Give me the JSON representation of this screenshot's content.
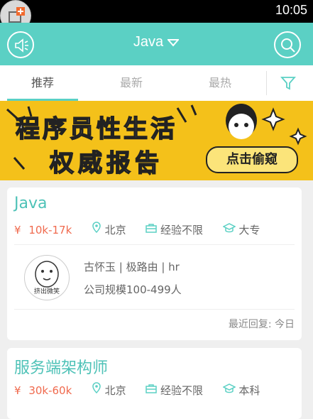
{
  "status": {
    "time": "10:05"
  },
  "header": {
    "title": "Java"
  },
  "tabs": [
    {
      "label": "推荐"
    },
    {
      "label": "最新"
    },
    {
      "label": "最热"
    }
  ],
  "banner": {
    "line1": "程序员性生活",
    "line2": "权威报告",
    "button": "点击偷窥"
  },
  "jobs": [
    {
      "title": "Java",
      "currency": "¥",
      "salary": "10k-17k",
      "city": "北京",
      "experience": "经验不限",
      "education": "大专",
      "hr_name": "古怀玉 | 极路由 | hr",
      "company": "公司规模100-499人",
      "avatar_caption": "挤出微笑",
      "reply": "最近回复: 今日"
    },
    {
      "title": "服务端架构师",
      "currency": "¥",
      "salary": "30k-60k",
      "city": "北京",
      "experience": "经验不限",
      "education": "本科"
    }
  ],
  "colors": {
    "accent": "#5bd0c4",
    "salary": "#f06a4e",
    "banner": "#f4c11a"
  }
}
